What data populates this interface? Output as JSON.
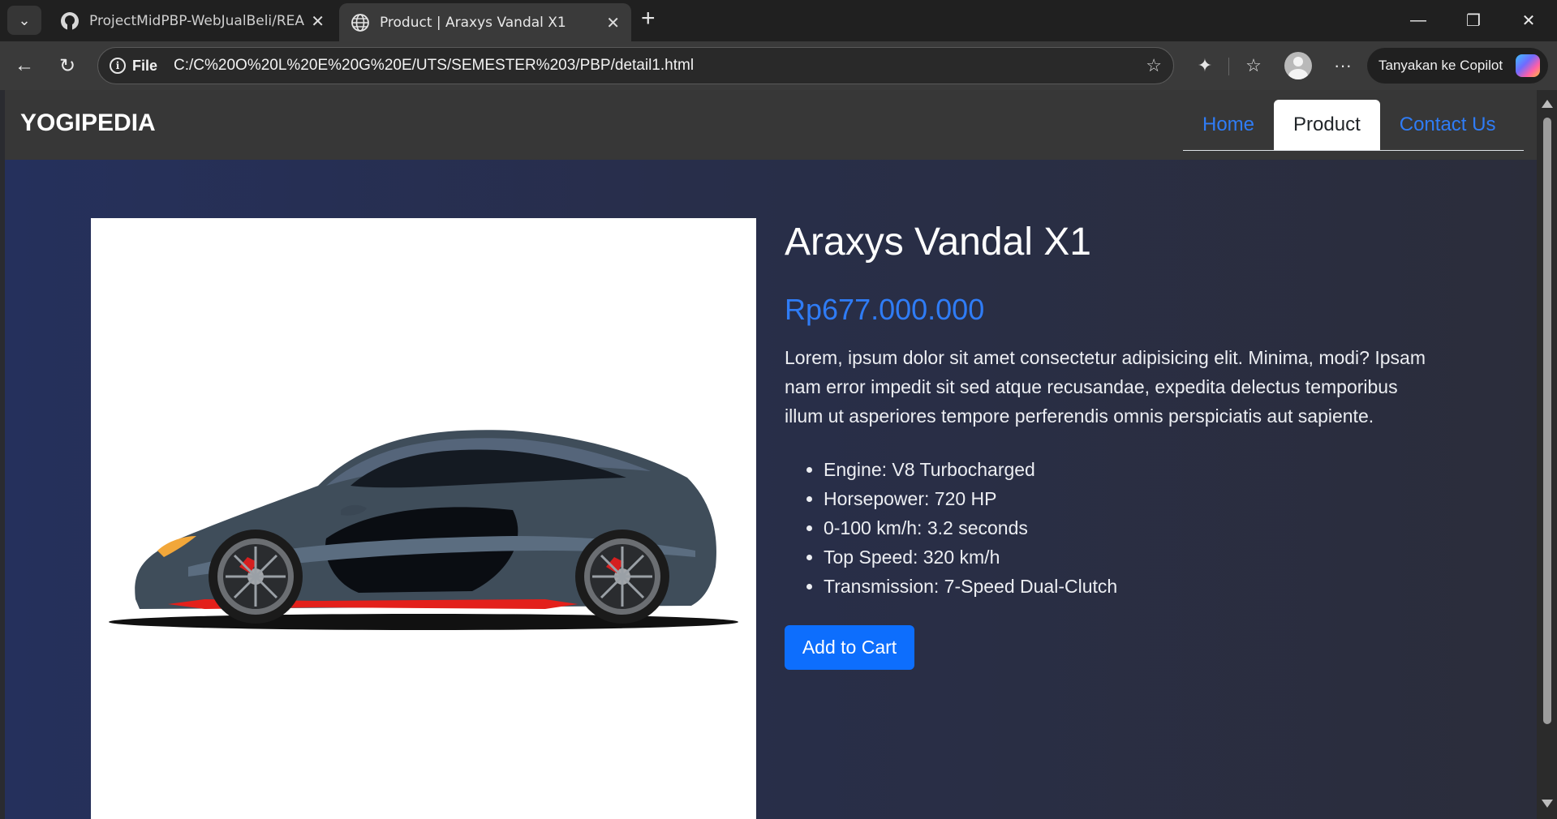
{
  "browser": {
    "tabs": [
      {
        "title": "ProjectMidPBP-WebJualBeli/README",
        "icon": "github-icon",
        "active": false
      },
      {
        "title": "Product | Araxys Vandal X1",
        "icon": "globe-icon",
        "active": true
      }
    ],
    "address": {
      "scheme_label": "File",
      "url": "C:/C%20O%20L%20E%20G%20E/UTS/SEMESTER%203/PBP/detail1.html"
    },
    "copilot_label": "Tanyakan ke Copilot"
  },
  "site": {
    "brand": "YOGIPEDIA",
    "nav": [
      {
        "label": "Home",
        "active": false
      },
      {
        "label": "Product",
        "active": true
      },
      {
        "label": "Contact Us",
        "active": false
      }
    ]
  },
  "product": {
    "title": "Araxys Vandal X1",
    "price": "Rp677.000.000",
    "description": "Lorem, ipsum dolor sit amet consectetur adipisicing elit. Minima, modi? Ipsam nam error impedit sit sed atque recusandae, expedita delectus temporibus illum ut asperiores tempore perferendis omnis perspiciatis aut sapiente.",
    "specs": [
      "Engine: V8 Turbocharged",
      "Horsepower: 720 HP",
      "0-100 km/h: 3.2 seconds",
      "Top Speed: 320 km/h",
      "Transmission: 7-Speed Dual-Clutch"
    ],
    "add_to_cart_label": "Add to Cart",
    "accent_color": "#0d6efd"
  }
}
